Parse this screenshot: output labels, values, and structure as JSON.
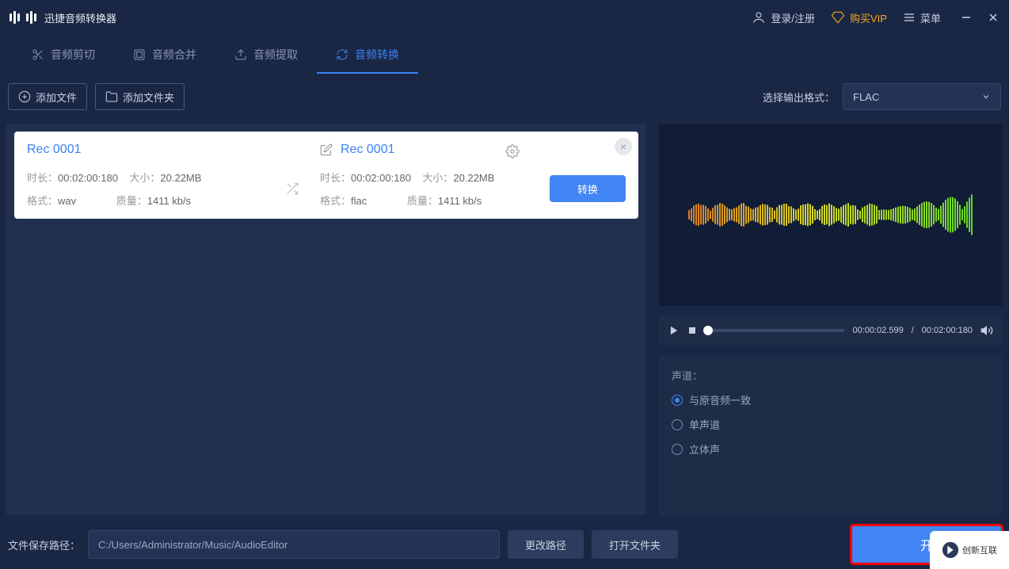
{
  "app": {
    "title": "迅捷音频转换器"
  },
  "header": {
    "login": "登录/注册",
    "vip": "购买VIP",
    "menu": "菜单"
  },
  "tabs": {
    "cut": "音频剪切",
    "merge": "音频合并",
    "extract": "音频提取",
    "convert": "音频转换"
  },
  "toolbar": {
    "add_file": "添加文件",
    "add_folder": "添加文件夹",
    "output_label": "选择输出格式：",
    "output_value": "FLAC"
  },
  "file": {
    "src_name": "Rec 0001",
    "tgt_name": "Rec 0001",
    "src": {
      "duration_lbl": "时长：",
      "duration": "00:02:00:180",
      "size_lbl": "大小：",
      "size": "20.22MB",
      "format_lbl": "格式：",
      "format": "wav",
      "quality_lbl": "质量：",
      "quality": "1411 kb/s"
    },
    "tgt": {
      "duration_lbl": "时长：",
      "duration": "00:02:00:180",
      "size_lbl": "大小：",
      "size": "20.22MB",
      "format_lbl": "格式：",
      "format": "flac",
      "quality_lbl": "质量：",
      "quality": "1411 kb/s"
    },
    "convert_btn": "转换"
  },
  "player": {
    "current": "00:00:02.599",
    "sep": " / ",
    "total": "00:02:00:180"
  },
  "settings": {
    "channel_label": "声道：",
    "opt_same": "与原音频一致",
    "opt_mono": "单声道",
    "opt_stereo": "立体声"
  },
  "footer": {
    "path_label": "文件保存路径：",
    "path_value": "C:/Users/Administrator/Music/AudioEditor",
    "change_path": "更改路径",
    "open_folder": "打开文件夹",
    "start": "开"
  },
  "watermark": "创新互联"
}
